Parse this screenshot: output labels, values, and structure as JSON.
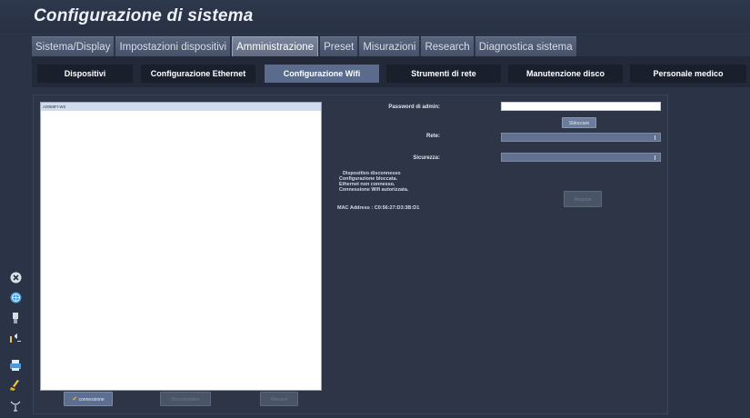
{
  "header": {
    "title": "Configurazione di sistema"
  },
  "main_tabs": [
    {
      "label": "Sistema/Display",
      "active": false
    },
    {
      "label": "Impostazioni dispositivi",
      "active": false
    },
    {
      "label": "Amministrazione",
      "active": true
    },
    {
      "label": "Preset",
      "active": false
    },
    {
      "label": "Misurazioni",
      "active": false
    },
    {
      "label": "Research",
      "active": false
    },
    {
      "label": "Diagnostica sistema",
      "active": false
    }
  ],
  "sub_tabs": [
    {
      "label": "Dispositivi",
      "active": false
    },
    {
      "label": "Configurazione Ethernet",
      "active": false
    },
    {
      "label": "Configurazione Wifi",
      "active": true
    },
    {
      "label": "Strumenti di rete",
      "active": false
    },
    {
      "label": "Manutenzione disco",
      "active": false
    },
    {
      "label": "Personale medico",
      "active": false
    }
  ],
  "wifi": {
    "networks": [
      "A0069FI-W2"
    ],
    "buttons": {
      "connect": "connessione",
      "disconnect": "Disconnettere",
      "forget": "Rimuovi"
    },
    "admin_password_label": "Password di admin:",
    "admin_password_value": "",
    "unlock_button": "Sbloccare",
    "network_label": "Rete:",
    "network_value": "",
    "security_label": "Sicurezza:",
    "security_value": "",
    "status_lines": [
      "Dispositivo disconnesso",
      "Configurazione bloccata.",
      "Ethernet non connesso.",
      "Connessione Wifi autorizzata."
    ],
    "mac_address": "MAC Address : C0:56:27:D3:3B:D1",
    "register_button": "Registra"
  },
  "sidebar_icons": [
    "close-icon",
    "globe-icon",
    "usb-icon",
    "volume-icon",
    "printer-icon",
    "clean-icon",
    "probe-icon"
  ],
  "colors": {
    "background": "#2b3446",
    "active_subtab": "#5a6b8c",
    "connect_button": "#5b6f93"
  }
}
